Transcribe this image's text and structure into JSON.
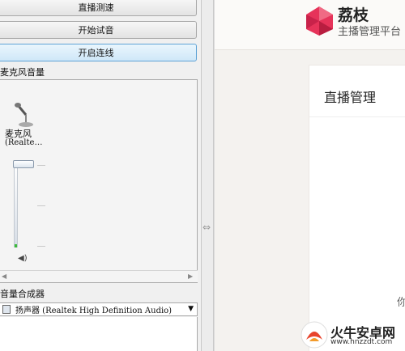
{
  "left_panel": {
    "buttons": [
      {
        "label": "直播测速"
      },
      {
        "label": "开始试音"
      },
      {
        "label": "开启连线"
      }
    ],
    "mic_section_label": "麦克风音量",
    "mic": {
      "name": "麦克风",
      "sub": "(Realte…",
      "volume_level": 0.98
    },
    "mixer_label": "音量合成器",
    "output_device": "扬声器 (Realtek High Definition Audio)"
  },
  "app": {
    "brand": "荔枝",
    "brand_sub": "主播管理平台",
    "card_title": "直播管理",
    "card_text": "你"
  },
  "watermark": {
    "text": "火牛安卓网",
    "url": "www.hnzzdt.com"
  },
  "colors": {
    "accent_button": "#cfe7f8",
    "meter_green": "#3cba3c",
    "brand_red": "#e6335a"
  }
}
